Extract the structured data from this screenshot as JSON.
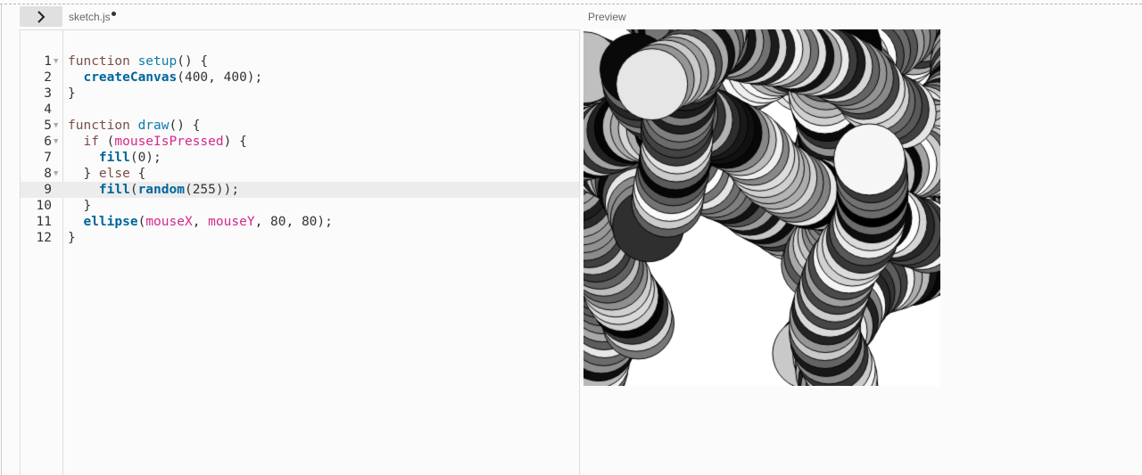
{
  "toolbar": {
    "toggle_icon": "chevron-right-icon",
    "file_name": "sketch.js",
    "unsaved": true
  },
  "preview": {
    "label": "Preview"
  },
  "editor": {
    "active_line": 9,
    "lines": [
      {
        "n": "1",
        "fold": true,
        "tokens": [
          [
            "function ",
            "kw"
          ],
          [
            "setup",
            "fn"
          ],
          [
            "() {",
            ""
          ]
        ]
      },
      {
        "n": "2",
        "fold": false,
        "tokens": [
          [
            "  ",
            ""
          ],
          [
            "createCanvas",
            "bi"
          ],
          [
            "(400, 400);",
            ""
          ]
        ]
      },
      {
        "n": "3",
        "fold": false,
        "tokens": [
          [
            "}",
            ""
          ]
        ]
      },
      {
        "n": "4",
        "fold": false,
        "tokens": []
      },
      {
        "n": "5",
        "fold": true,
        "tokens": [
          [
            "function ",
            "kw"
          ],
          [
            "draw",
            "fn"
          ],
          [
            "() {",
            ""
          ]
        ]
      },
      {
        "n": "6",
        "fold": true,
        "tokens": [
          [
            "  if ",
            "kw"
          ],
          [
            "(",
            ""
          ],
          [
            "mouseIsPressed",
            "var"
          ],
          [
            ") {",
            ""
          ]
        ]
      },
      {
        "n": "7",
        "fold": false,
        "tokens": [
          [
            "    ",
            ""
          ],
          [
            "fill",
            "bi"
          ],
          [
            "(0);",
            ""
          ]
        ]
      },
      {
        "n": "8",
        "fold": true,
        "tokens": [
          [
            "  } ",
            ""
          ],
          [
            "else",
            "kw"
          ],
          [
            " {",
            ""
          ]
        ]
      },
      {
        "n": "9",
        "fold": false,
        "tokens": [
          [
            "    ",
            ""
          ],
          [
            "fill",
            "bi"
          ],
          [
            "(",
            ""
          ],
          [
            "random",
            "bi"
          ],
          [
            "(255));",
            ""
          ]
        ]
      },
      {
        "n": "10",
        "fold": false,
        "tokens": [
          [
            "  }",
            ""
          ]
        ]
      },
      {
        "n": "11",
        "fold": false,
        "tokens": [
          [
            "  ",
            ""
          ],
          [
            "ellipse",
            "bi"
          ],
          [
            "(",
            ""
          ],
          [
            "mouseX",
            "var"
          ],
          [
            ", ",
            ""
          ],
          [
            "mouseY",
            "var"
          ],
          [
            ", 80, 80);",
            ""
          ]
        ]
      },
      {
        "n": "12",
        "fold": false,
        "tokens": [
          [
            "}",
            ""
          ]
        ]
      }
    ]
  }
}
